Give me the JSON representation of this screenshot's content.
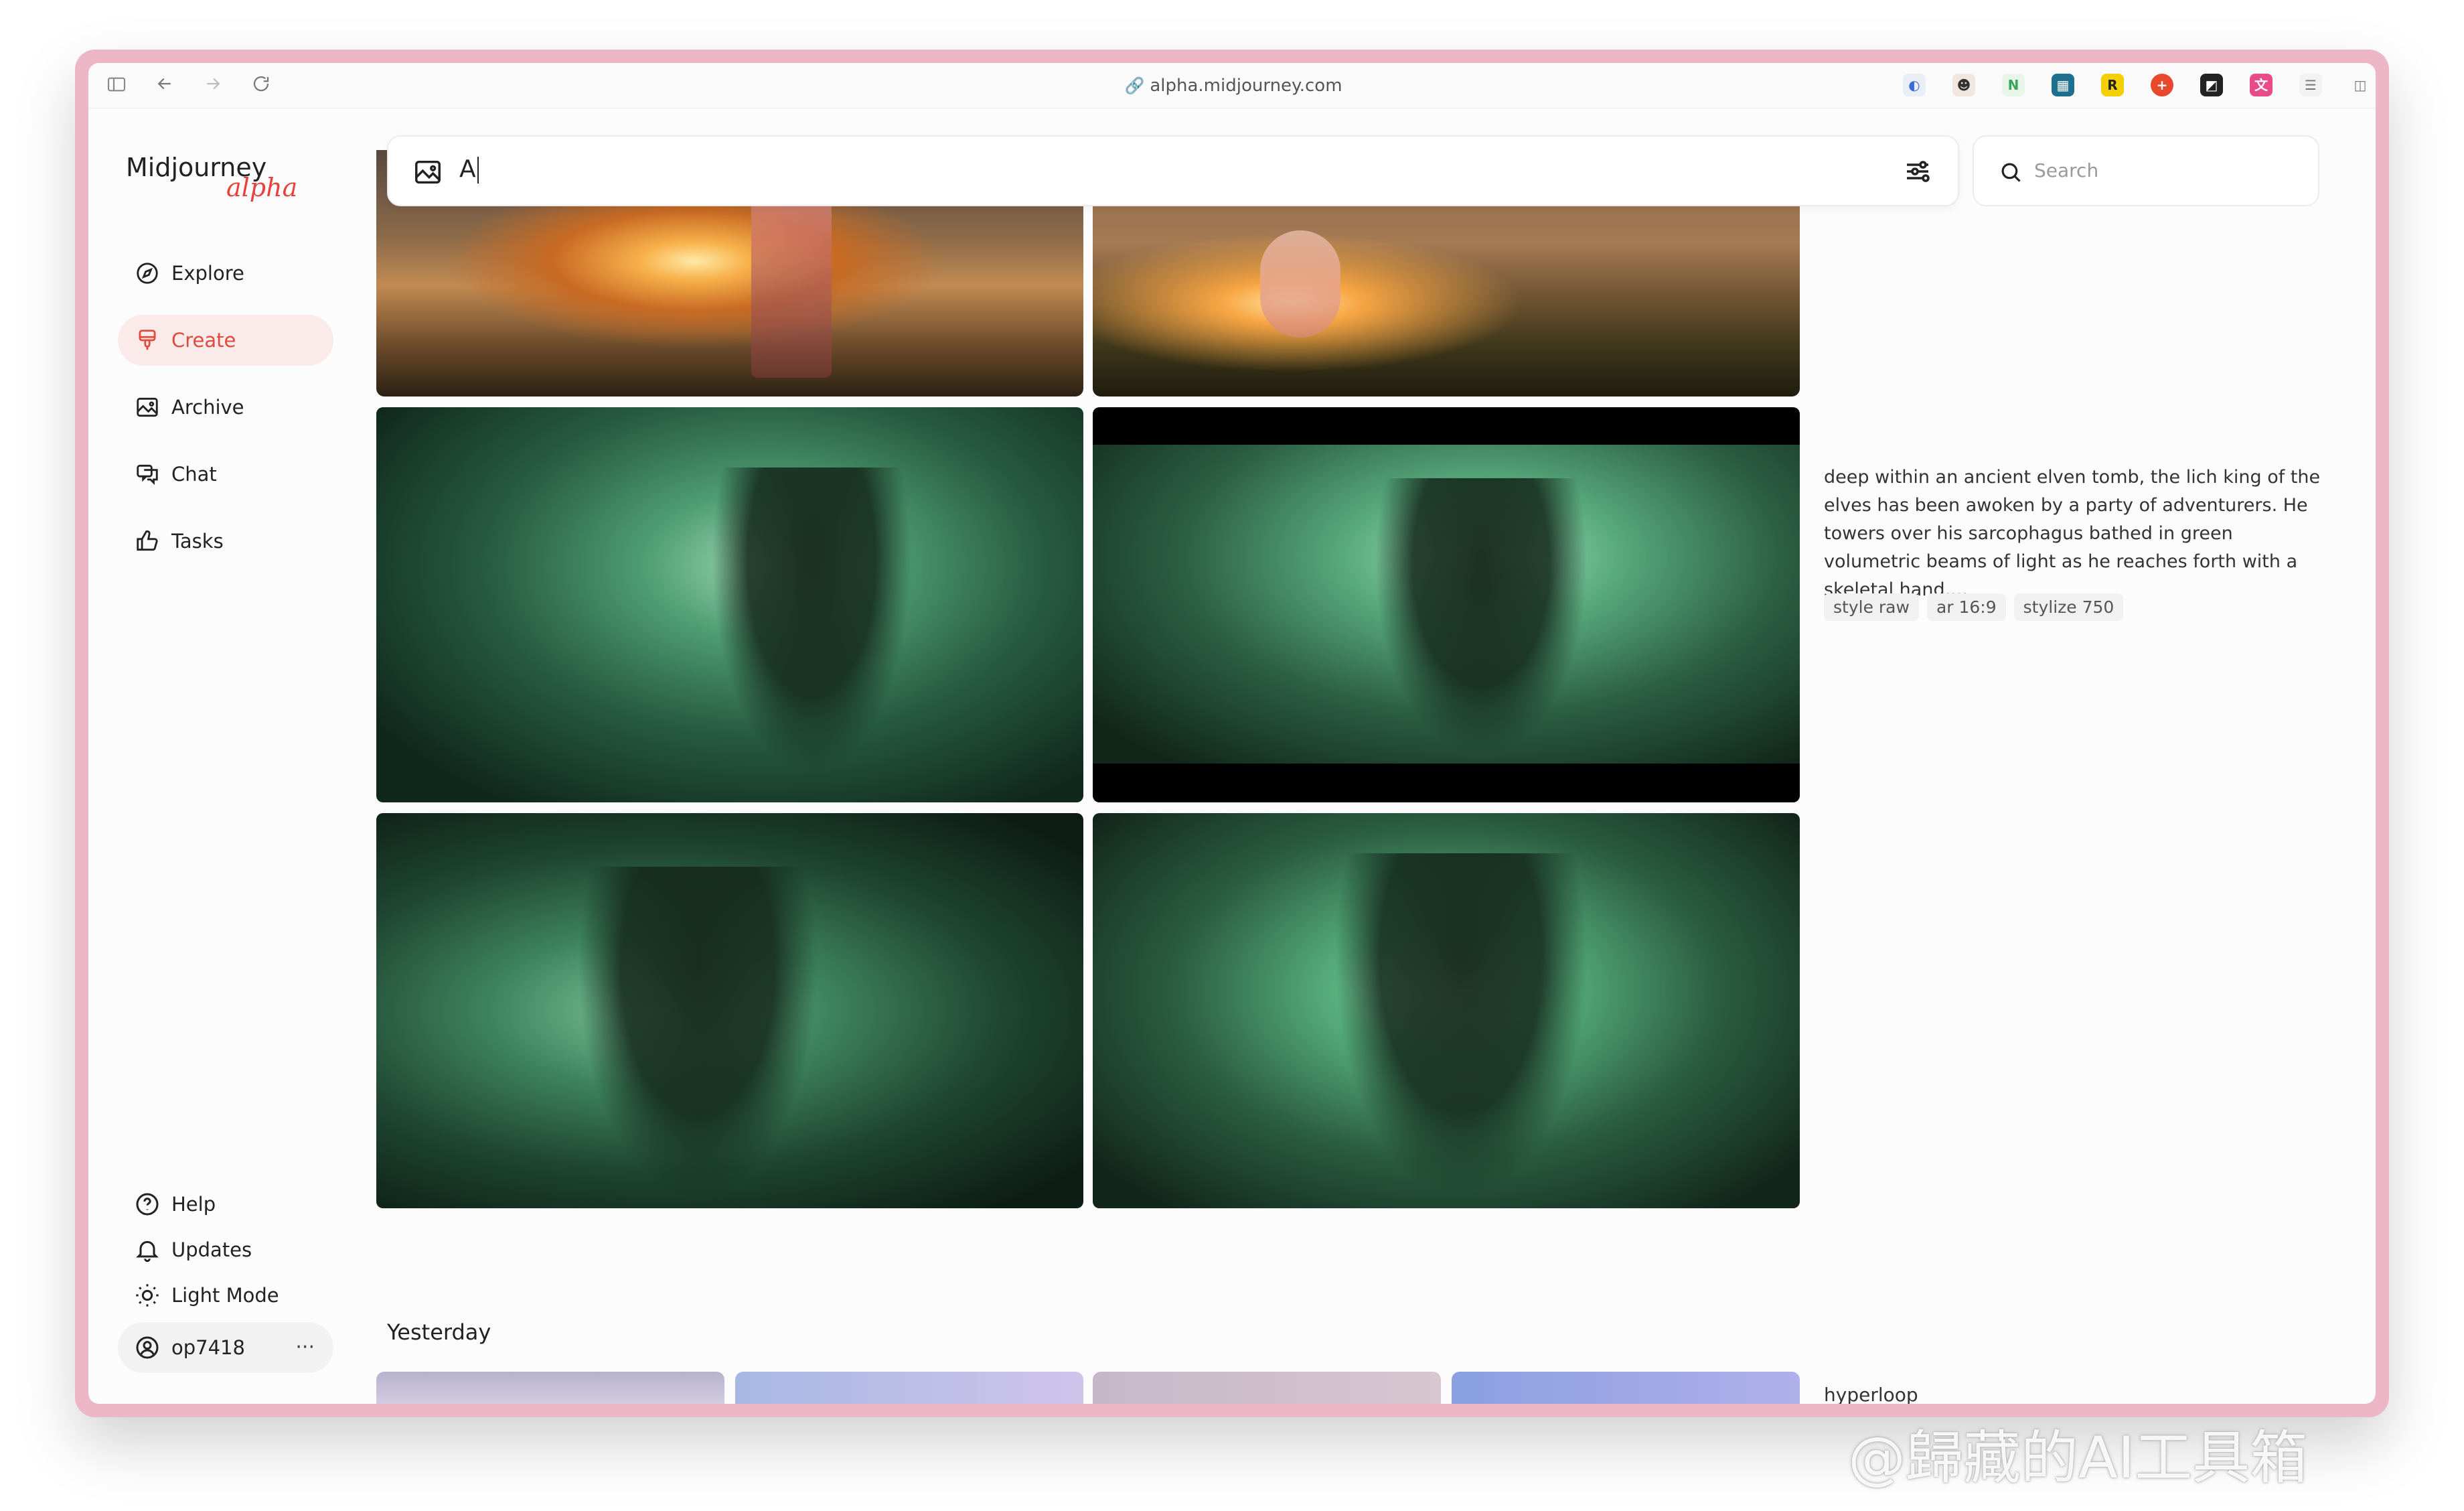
{
  "browser": {
    "url": "alpha.midjourney.com"
  },
  "app": {
    "logo": "Midjourney",
    "logo_badge": "alpha"
  },
  "sidebar": {
    "items": [
      {
        "label": "Explore",
        "icon": "compass-icon"
      },
      {
        "label": "Create",
        "icon": "brush-icon",
        "active": true
      },
      {
        "label": "Archive",
        "icon": "image-icon"
      },
      {
        "label": "Chat",
        "icon": "chat-icon"
      },
      {
        "label": "Tasks",
        "icon": "thumbs-up-icon"
      }
    ],
    "footer": [
      {
        "label": "Help",
        "icon": "help-icon"
      },
      {
        "label": "Updates",
        "icon": "bell-icon"
      },
      {
        "label": "Light Mode",
        "icon": "sun-icon"
      }
    ],
    "user": {
      "name": "op7418",
      "more": "···"
    }
  },
  "prompt_bar": {
    "value": "A"
  },
  "search": {
    "placeholder": "Search"
  },
  "job": {
    "prompt": "deep within an ancient elven tomb, the lich king of the elves has been awoken by a party of adventurers. He towers over his sarcophagus bathed in green volumetric beams of light as he reaches forth with a skeletal hand,...",
    "tags": [
      "style raw",
      "ar 16:9",
      "stylize 750"
    ]
  },
  "sections": {
    "yesterday": "Yesterday",
    "next_prompt": "hyperloop"
  },
  "watermark": "@歸藏的AI工具箱",
  "colors": {
    "accent": "#e04a3c",
    "active_bg": "#fbeaea",
    "frame": "#ecb6c6"
  }
}
